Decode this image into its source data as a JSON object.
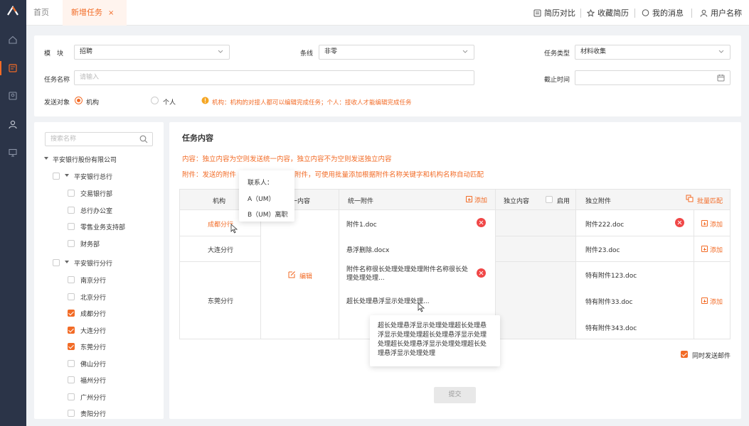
{
  "nav": {
    "rail_icons": [
      "logo-icon",
      "home-icon",
      "task-icon",
      "resume-icon",
      "user-icon",
      "monitor-icon"
    ],
    "home_tab": "首页",
    "active_tab": "新增任务",
    "close_glyph": "×",
    "right": {
      "compare": "简历对比",
      "favorites": "收藏简历",
      "messages": "我的消息",
      "user": "用户名称"
    }
  },
  "form": {
    "module_label": "模　块",
    "module_value": "招聘",
    "line_label": "条线",
    "line_value": "非零",
    "task_type_label": "任务类型",
    "task_type_value": "材料收集",
    "task_name_label": "任务名称",
    "task_name_placeholder": "请输入",
    "deadline_label": "截止时间",
    "send_target_label": "发送对象",
    "option_org": "机构",
    "option_person": "个人",
    "hint": "机构：机构的对接人都可以编辑完成任务；个人：接收人才能编辑完成任务"
  },
  "tree": {
    "search_placeholder": "搜索名称",
    "root": "平安银行股份有限公司",
    "groups": [
      {
        "label": "平安银行总行",
        "children": [
          {
            "label": "交易银行部",
            "checked": false
          },
          {
            "label": "总行办公室",
            "checked": false
          },
          {
            "label": "零售业务支持部",
            "checked": false
          },
          {
            "label": "财务部",
            "checked": false
          }
        ]
      },
      {
        "label": "平安银行分行",
        "children": [
          {
            "label": "南京分行",
            "checked": false
          },
          {
            "label": "北京分行",
            "checked": false
          },
          {
            "label": "成都分行",
            "checked": true
          },
          {
            "label": "大连分行",
            "checked": true
          },
          {
            "label": "东莞分行",
            "checked": true
          },
          {
            "label": "佛山分行",
            "checked": false
          },
          {
            "label": "福州分行",
            "checked": false
          },
          {
            "label": "广州分行",
            "checked": false
          },
          {
            "label": "贵阳分行",
            "checked": false
          }
        ]
      }
    ]
  },
  "content": {
    "title": "任务内容",
    "note1": "内容：独立内容为空则发送统一内容，独立内容不为空则发送独立内容",
    "note2a": "附件：发送的附件",
    "note2b": "附件，可使用批量添加根据附件名称关键字和机构名称自动匹配",
    "table": {
      "col_org": "机构",
      "col_unified_content": "一内容",
      "col_unified_attach": "统一附件",
      "add": "添加",
      "col_indep_content": "独立内容",
      "enable": "启用",
      "col_indep_attach": "独立附件",
      "batch_match": "批量匹配",
      "orgs": [
        "成都分行",
        "大连分行",
        "东莞分行"
      ],
      "edit": "编辑",
      "unified_attachments": [
        "附件1.doc",
        "悬浮删除.docx",
        "附件名称很长处理处理处理附件名称很长处理处理处理...",
        "超长处理悬浮显示处理处理..."
      ],
      "indep_attachments": [
        "附件222.doc",
        "附件23.doc",
        "特有附件123.doc",
        "特有附件33.doc",
        "特有附件343.doc"
      ]
    },
    "contact_popup": {
      "title": "联系人：",
      "items": [
        "A（UM）",
        "B（UM）离职"
      ]
    },
    "tooltip": "超长处理悬浮显示处理处理超长处理悬浮显示处理处理超长处理悬浮显示处理处理超长处理悬浮显示处理处理超长处理悬浮显示处理处理",
    "send_email": "同时发送邮件",
    "submit": "提交"
  },
  "colors": {
    "accent": "#f26b26",
    "rail": "#2b3448",
    "danger": "#f04747"
  }
}
